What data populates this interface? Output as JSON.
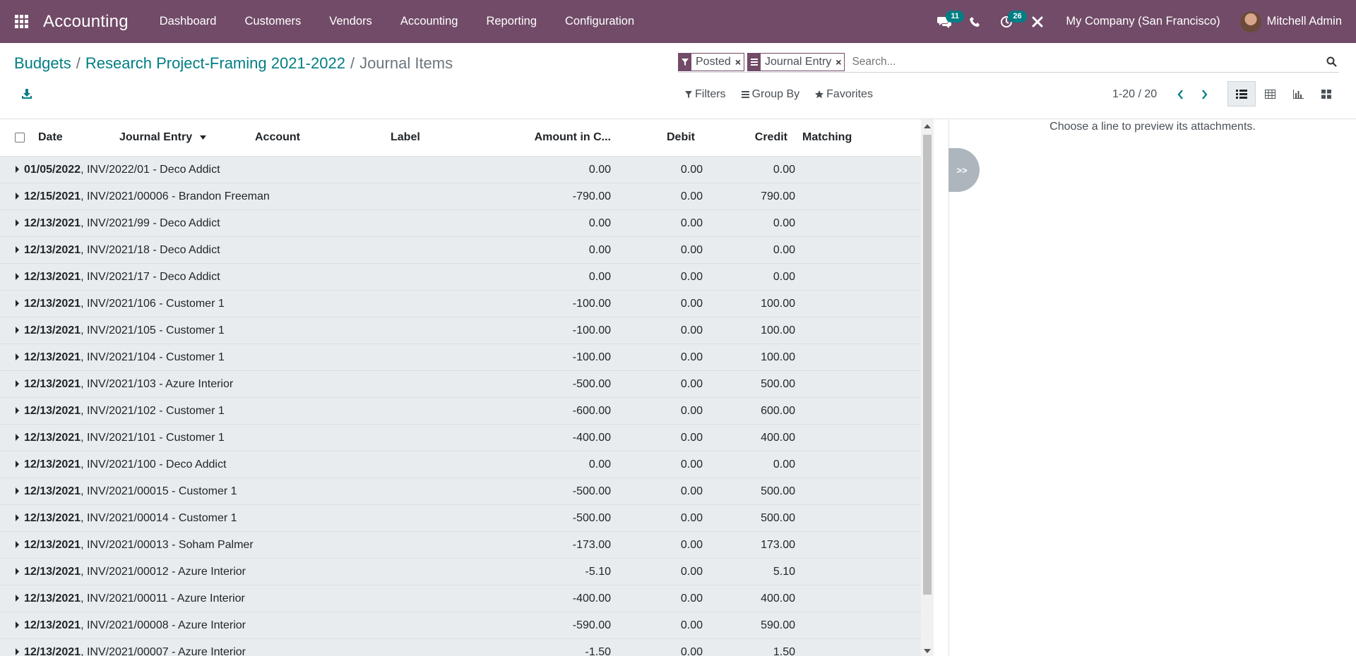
{
  "navbar": {
    "brand": "Accounting",
    "menu": [
      "Dashboard",
      "Customers",
      "Vendors",
      "Accounting",
      "Reporting",
      "Configuration"
    ],
    "messages_badge": "11",
    "activities_badge": "26",
    "company": "My Company (San Francisco)",
    "user": "Mitchell Admin"
  },
  "breadcrumb": {
    "item1": "Budgets",
    "item2": "Research Project-Framing 2021-2022",
    "current": "Journal Items",
    "sep": "/"
  },
  "search": {
    "facets": [
      {
        "icon": "filter-icon",
        "value": "Posted"
      },
      {
        "icon": "group-icon",
        "value": "Journal Entry"
      }
    ],
    "placeholder": "Search..."
  },
  "filters": {
    "filters_label": "Filters",
    "groupby_label": "Group By",
    "favorites_label": "Favorites"
  },
  "pager": {
    "value": "1-20 / 20"
  },
  "list": {
    "headers": {
      "date": "Date",
      "journal_entry": "Journal Entry",
      "account": "Account",
      "label": "Label",
      "amount": "Amount in C...",
      "debit": "Debit",
      "credit": "Credit",
      "matching": "Matching"
    },
    "rows": [
      {
        "date": "01/05/2022",
        "entry": ", INV/2022/01 - Deco Addict",
        "amount": "0.00",
        "debit": "0.00",
        "credit": "0.00"
      },
      {
        "date": "12/15/2021",
        "entry": ", INV/2021/00006 - Brandon Freeman",
        "amount": "-790.00",
        "debit": "0.00",
        "credit": "790.00"
      },
      {
        "date": "12/13/2021",
        "entry": ", INV/2021/99 - Deco Addict",
        "amount": "0.00",
        "debit": "0.00",
        "credit": "0.00"
      },
      {
        "date": "12/13/2021",
        "entry": ", INV/2021/18 - Deco Addict",
        "amount": "0.00",
        "debit": "0.00",
        "credit": "0.00"
      },
      {
        "date": "12/13/2021",
        "entry": ", INV/2021/17 - Deco Addict",
        "amount": "0.00",
        "debit": "0.00",
        "credit": "0.00"
      },
      {
        "date": "12/13/2021",
        "entry": ", INV/2021/106 - Customer 1",
        "amount": "-100.00",
        "debit": "0.00",
        "credit": "100.00"
      },
      {
        "date": "12/13/2021",
        "entry": ", INV/2021/105 - Customer 1",
        "amount": "-100.00",
        "debit": "0.00",
        "credit": "100.00"
      },
      {
        "date": "12/13/2021",
        "entry": ", INV/2021/104 - Customer 1",
        "amount": "-100.00",
        "debit": "0.00",
        "credit": "100.00"
      },
      {
        "date": "12/13/2021",
        "entry": ", INV/2021/103 - Azure Interior",
        "amount": "-500.00",
        "debit": "0.00",
        "credit": "500.00"
      },
      {
        "date": "12/13/2021",
        "entry": ", INV/2021/102 - Customer 1",
        "amount": "-600.00",
        "debit": "0.00",
        "credit": "600.00"
      },
      {
        "date": "12/13/2021",
        "entry": ", INV/2021/101 - Customer 1",
        "amount": "-400.00",
        "debit": "0.00",
        "credit": "400.00"
      },
      {
        "date": "12/13/2021",
        "entry": ", INV/2021/100 - Deco Addict",
        "amount": "0.00",
        "debit": "0.00",
        "credit": "0.00"
      },
      {
        "date": "12/13/2021",
        "entry": ", INV/2021/00015 - Customer 1",
        "amount": "-500.00",
        "debit": "0.00",
        "credit": "500.00"
      },
      {
        "date": "12/13/2021",
        "entry": ", INV/2021/00014 - Customer 1",
        "amount": "-500.00",
        "debit": "0.00",
        "credit": "500.00"
      },
      {
        "date": "12/13/2021",
        "entry": ", INV/2021/00013 - Soham Palmer",
        "amount": "-173.00",
        "debit": "0.00",
        "credit": "173.00"
      },
      {
        "date": "12/13/2021",
        "entry": ", INV/2021/00012 - Azure Interior",
        "amount": "-5.10",
        "debit": "0.00",
        "credit": "5.10"
      },
      {
        "date": "12/13/2021",
        "entry": ", INV/2021/00011 - Azure Interior",
        "amount": "-400.00",
        "debit": "0.00",
        "credit": "400.00"
      },
      {
        "date": "12/13/2021",
        "entry": ", INV/2021/00008 - Azure Interior",
        "amount": "-590.00",
        "debit": "0.00",
        "credit": "590.00"
      },
      {
        "date": "12/13/2021",
        "entry": ", INV/2021/00007 - Azure Interior",
        "amount": "-1.50",
        "debit": "0.00",
        "credit": "1.50"
      }
    ]
  },
  "preview": {
    "message": "Choose a line to preview its attachments.",
    "toggle_label": ">>"
  },
  "colors": {
    "brand": "#714b67",
    "accent": "#017e84",
    "row_bg": "#e9ecef"
  }
}
